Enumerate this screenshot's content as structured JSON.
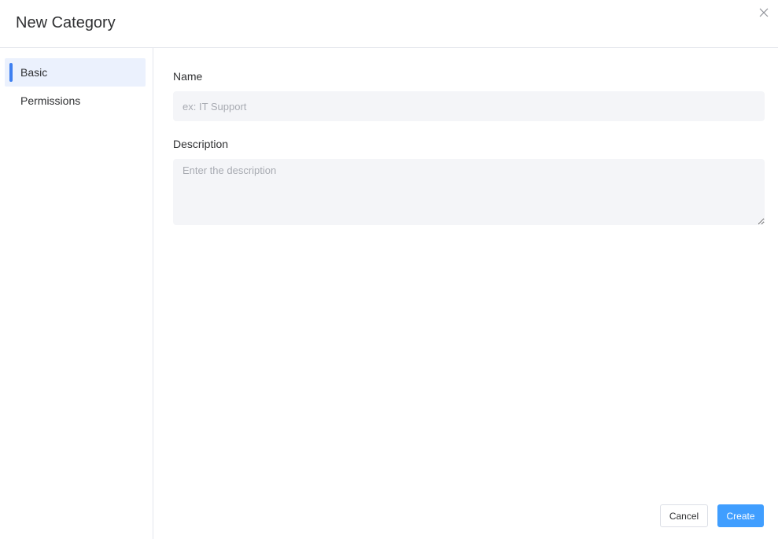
{
  "dialog": {
    "title": "New Category"
  },
  "sidebar": {
    "items": [
      {
        "label": "Basic",
        "active": true
      },
      {
        "label": "Permissions",
        "active": false
      }
    ]
  },
  "form": {
    "name": {
      "label": "Name",
      "value": "",
      "placeholder": "ex: IT Support"
    },
    "description": {
      "label": "Description",
      "value": "",
      "placeholder": "Enter the description"
    }
  },
  "footer": {
    "cancel_label": "Cancel",
    "create_label": "Create"
  },
  "colors": {
    "accent": "#3d7ff0",
    "primary_button": "#409eff",
    "active_nav_bg": "#ebf1fd",
    "input_bg": "#f4f5f8"
  },
  "icons": {
    "close": "close-icon"
  }
}
